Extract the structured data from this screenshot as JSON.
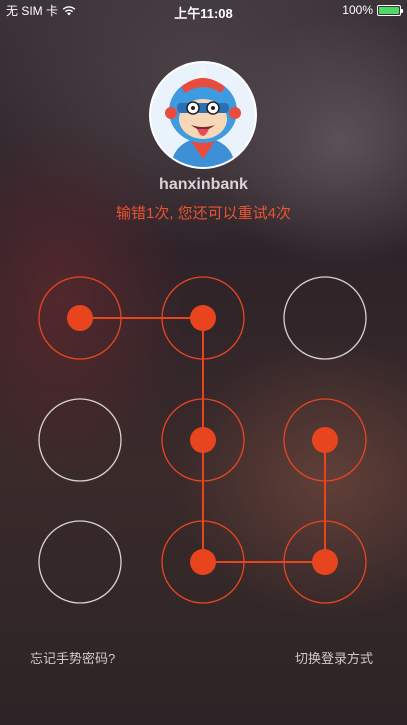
{
  "status_bar": {
    "carrier": "无 SIM 卡",
    "time": "上午11:08",
    "battery_percent": "100%",
    "wifi_icon": "wifi-icon",
    "battery_icon": "battery-icon"
  },
  "user": {
    "avatar_icon": "cartoon-avatar",
    "username": "hanxinbank"
  },
  "message": {
    "error": "输错1次, 您还可以重试4次",
    "error_color": "#ea5430"
  },
  "pattern": {
    "nodes": [
      {
        "id": 1,
        "row": 1,
        "col": 1,
        "selected": true
      },
      {
        "id": 2,
        "row": 1,
        "col": 2,
        "selected": true
      },
      {
        "id": 3,
        "row": 1,
        "col": 3,
        "selected": false
      },
      {
        "id": 4,
        "row": 2,
        "col": 1,
        "selected": false
      },
      {
        "id": 5,
        "row": 2,
        "col": 2,
        "selected": true
      },
      {
        "id": 6,
        "row": 2,
        "col": 3,
        "selected": true
      },
      {
        "id": 7,
        "row": 3,
        "col": 1,
        "selected": false
      },
      {
        "id": 8,
        "row": 3,
        "col": 2,
        "selected": true
      },
      {
        "id": 9,
        "row": 3,
        "col": 3,
        "selected": true
      }
    ],
    "path": [
      1,
      2,
      5,
      8,
      9,
      6
    ],
    "active_color": "#e8451f",
    "inactive_color": "#d6d2d4"
  },
  "footer": {
    "forgot": "忘记手势密码?",
    "switch_login": "切换登录方式"
  }
}
